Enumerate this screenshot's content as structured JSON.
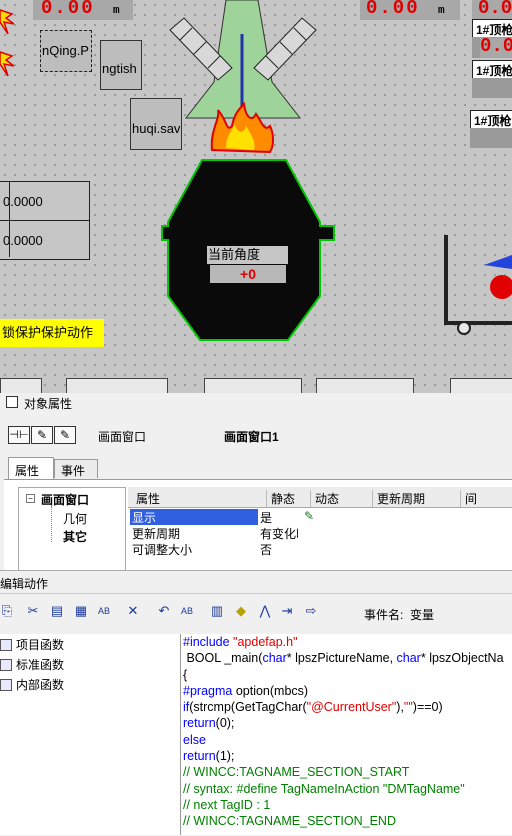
{
  "hmi": {
    "display_left": "0.00",
    "display_left_unit": "m",
    "display_right": "0.00",
    "display_right_unit": "m",
    "display_far_right": "0.0",
    "obj_box1": "nQing.P",
    "obj_box2": "ngtish",
    "obj_box3": "huqi.sav",
    "table_values": [
      "0.0000",
      "0.0000"
    ],
    "angle_label": "当前角度",
    "angle_value": "+0",
    "lock_text": "锁保护保护动作",
    "lance_tags": [
      "1#顶枪",
      "1#顶枪",
      "1#顶枪"
    ],
    "lance_values": [
      "0.0"
    ],
    "bottom_labels": [
      "...",
      "...",
      "...",
      "...",
      "..."
    ]
  },
  "dialog": {
    "title": "对象属性",
    "picture_label": "画面窗口",
    "picture_value": "画面窗口1",
    "tabs": [
      "属性",
      "事件"
    ],
    "tree": {
      "root": "画面窗口",
      "children": [
        "几何",
        "其它"
      ]
    },
    "columns": [
      "属性",
      "静态",
      "动态",
      "更新周期",
      "间"
    ],
    "rows": [
      {
        "name": "显示",
        "static": "是",
        "selected": true
      },
      {
        "name": "更新周期",
        "static": "有变化时"
      },
      {
        "name": "可调整大小",
        "static": "否"
      }
    ]
  },
  "editor": {
    "title": "编辑动作",
    "event_label": "事件名:",
    "event_value": "变量",
    "functions": [
      "项目函数",
      "标准函数",
      "内部函数"
    ],
    "code": [
      [
        {
          "t": "#include ",
          "c": "kw"
        },
        {
          "t": "\"apdefap.h\"",
          "c": "str"
        }
      ],
      [
        {
          "t": " BOOL _main(",
          "c": ""
        },
        {
          "t": "char",
          "c": "kw"
        },
        {
          "t": "* lpszPictureName, ",
          "c": ""
        },
        {
          "t": "char",
          "c": "kw"
        },
        {
          "t": "* lpszObjectNa",
          "c": ""
        }
      ],
      [
        {
          "t": "{",
          "c": ""
        }
      ],
      [
        {
          "t": "#pragma ",
          "c": "kw"
        },
        {
          "t": "option(mbcs)",
          "c": ""
        }
      ],
      [
        {
          "t": "if",
          "c": "kw"
        },
        {
          "t": "(strcmp(GetTagChar(",
          "c": ""
        },
        {
          "t": "\"@CurrentUser\"",
          "c": "str"
        },
        {
          "t": "),",
          "c": ""
        },
        {
          "t": "\"\"",
          "c": "str"
        },
        {
          "t": ")==0)",
          "c": ""
        }
      ],
      [
        {
          "t": "return",
          "c": "kw"
        },
        {
          "t": "(0);",
          "c": ""
        }
      ],
      [
        {
          "t": "else",
          "c": "kw"
        }
      ],
      [
        {
          "t": "return",
          "c": "kw"
        },
        {
          "t": "(1);",
          "c": ""
        }
      ],
      [
        {
          "t": "// WINCC:TAGNAME_SECTION_START",
          "c": "cm"
        }
      ],
      [
        {
          "t": "// syntax: #define TagNameInAction \"DMTagName\"",
          "c": "cm"
        }
      ],
      [
        {
          "t": "// next TagID : 1",
          "c": "cm"
        }
      ],
      [
        {
          "t": "// WINCC:TAGNAME_SECTION_END",
          "c": "cm"
        }
      ]
    ]
  },
  "colors": {
    "furnace_body": "#0a0a0a",
    "furnace_outline": "#00c800",
    "hood_green": "#9ed49a",
    "flame": "#ff8c00",
    "lock_bg": "#ffff00",
    "value_red": "#e00000",
    "code_keyword": "#0000ff",
    "code_string": "#e00000",
    "code_comment": "#008000"
  }
}
